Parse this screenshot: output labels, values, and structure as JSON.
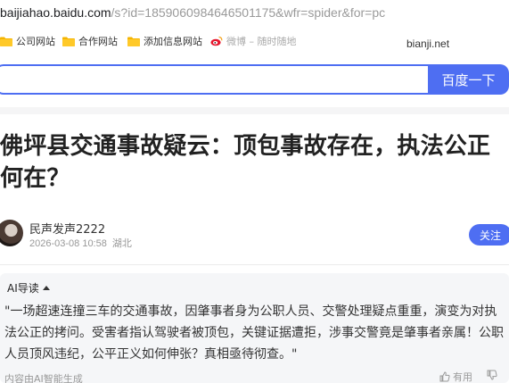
{
  "browser": {
    "address_host": "baijiahao.baidu.com",
    "address_rest": "/s?id=1859060984646501175&wfr=spider&for=pc"
  },
  "bookmarks": [
    {
      "label": "公司网站",
      "icon": "folder-icon"
    },
    {
      "label": "合作网站",
      "icon": "folder-icon"
    },
    {
      "label": "添加信息网站",
      "icon": "folder-icon"
    },
    {
      "label": "微博 – 随时随地",
      "icon": "weibo-icon"
    }
  ],
  "brand_label": "bianji.net",
  "search": {
    "value": "",
    "button_label": "百度一下"
  },
  "article": {
    "title": "佛坪县交通事故疑云：顶包事故存在，执法公正何在？",
    "author_name": "民声发声2222",
    "timestamp": "2026-03-08 10:58",
    "location": "湖北",
    "follow_label": "关注"
  },
  "ai_summary": {
    "heading": "AI导读",
    "text": "\"一场超速连撞三车的交通事故，因肇事者身为公职人员、交警处理疑点重重，演变为对执法公正的拷问。受害者指认驾驶者被顶包，关键证据遭拒，涉事交警竟是肇事者亲属！公职人员顶风违纪，公平正义如何伸张？真相亟待彻查。\"",
    "footer": "内容由AI智能生成",
    "useful_label": "有用"
  },
  "colors": {
    "accent": "#4e6ef2",
    "folder": "#f5b400"
  }
}
